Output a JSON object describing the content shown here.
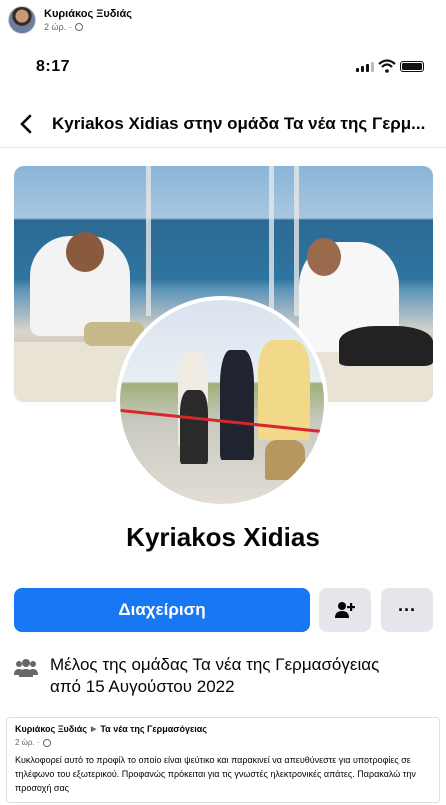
{
  "post": {
    "author": "Κυριάκος Ξυδιάς",
    "time": "2 ώρ. ·"
  },
  "phone": {
    "status_time": "8:17",
    "nav_title": "Kyriakos Xidias στην ομάδα Τα νέα της Γερμ..."
  },
  "profile": {
    "name": "Kyriakos Xidias",
    "manage_label": "Διαχείριση",
    "more_label": "···",
    "member_prefix": "Μέλος της ομάδας ",
    "group_name": "Τα νέα της Γερμασόγειας",
    "member_since": "από 15 Αυγούστου 2022"
  },
  "share": {
    "author": "Κυριάκος Ξυδιάς",
    "arrow": "▶",
    "group": "Τα νέα της Γερμασόγειας",
    "time": "2 ώρ. ·",
    "body": "Κυκλοφορεί αυτό το προφίλ το οποίο είναι ψεύτικο και παρακινεί να απευθύνεστε για υποτροφίες σε τηλέφωνο του εξωτερικού. Προφανώς πρόκειται για τις γνωστές ηλεκτρονικές απάτες. Παρακαλώ την προσοχή σας"
  },
  "colors": {
    "accent": "#1877f2",
    "secondary_button": "#e4e6eb",
    "meta_text": "#65676b"
  },
  "icons": {
    "back": "chevron-left-icon",
    "add_friend": "person-plus-icon",
    "group": "group-icon",
    "audience": "globe-icon"
  }
}
